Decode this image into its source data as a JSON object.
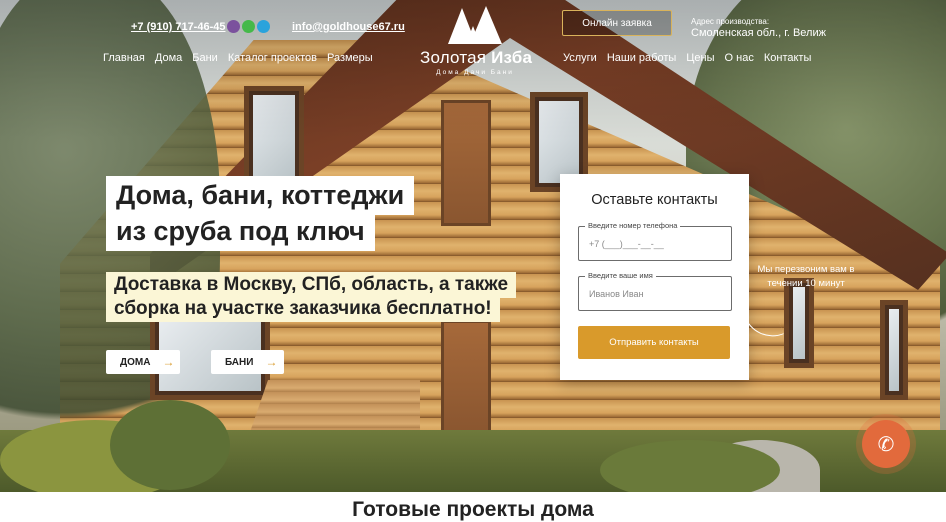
{
  "header": {
    "phone": "+7 (910) 717-46-45",
    "email": "info@goldhouse67.ru",
    "nav_left": [
      "Главная",
      "Дома",
      "Бани",
      "Каталог проектов",
      "Размеры"
    ],
    "nav_right": [
      "Услуги",
      "Наши работы",
      "Цены",
      "О нас",
      "Контакты"
    ],
    "logo_name_light": "Золотая ",
    "logo_name_bold": "Изба",
    "logo_tagline": "Дома Дачи Бани",
    "order_button": "Онлайн заявка",
    "address_label": "Адрес производства:",
    "address": "Смоленская обл., г. Велиж"
  },
  "hero": {
    "title_line1": "Дома, бани, коттеджи",
    "title_line2": "из сруба под ключ",
    "sub_line1": "Доставка в Москву, СПб, область, а также",
    "sub_line2": "сборка на участке заказчика бесплатно!",
    "btn_houses": "ДОМА",
    "btn_baths": "БАНИ",
    "arrow": "→"
  },
  "form": {
    "title": "Оставьте контакты",
    "phone_label": "Введите номер телефона",
    "phone_placeholder": "+7 (___)___-__-__",
    "name_label": "Введите ваше имя",
    "name_placeholder": "Иванов Иван",
    "submit": "Отправить контакты",
    "note": "Мы перезвоним вам в течении 10 минут"
  },
  "section": {
    "title": "Готовые проекты дома"
  },
  "colors": {
    "accent": "#d99a2b",
    "call_button": "#e26a3c",
    "viber": "#7b519d",
    "whatsapp": "#45b94a",
    "telegram": "#2aa3dc"
  }
}
